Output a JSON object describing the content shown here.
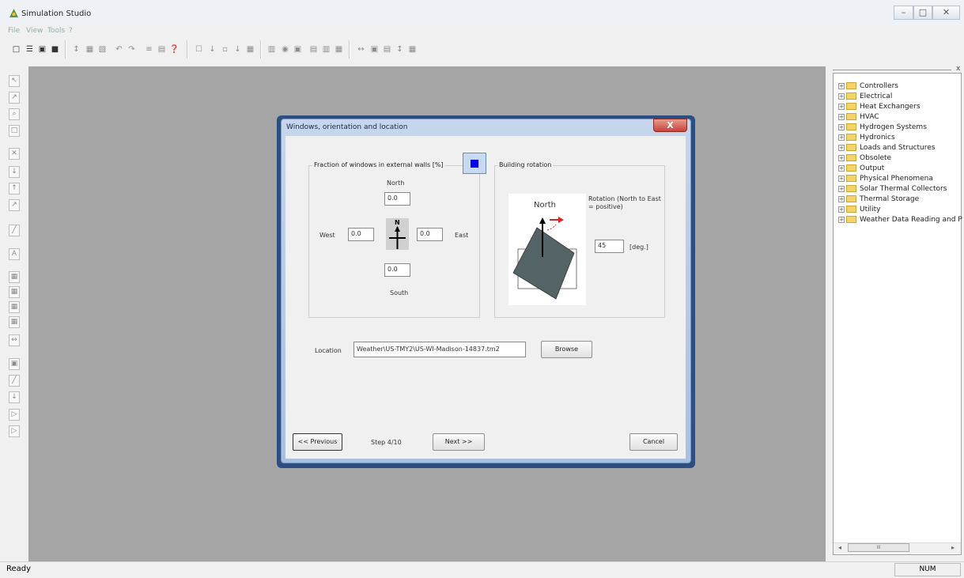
{
  "window": {
    "title": "Simulation Studio",
    "min": "–",
    "max": "□",
    "close": "✕"
  },
  "menu": [
    "File",
    "View",
    "Tools",
    "?"
  ],
  "toolbar_icons": [
    "□",
    "☰",
    "▣",
    "■",
    "↕",
    "▦",
    "▧",
    "↶",
    "↷",
    "≡",
    "▤",
    "❓",
    "☐",
    "↓",
    "▫",
    "↓",
    "▦",
    "▥",
    "◉",
    "▣",
    "▤",
    "▥",
    "▦",
    "↔",
    "▣",
    "▤",
    "↕",
    "▦"
  ],
  "left_tools": [
    "↖",
    "↗",
    "⌕",
    "□",
    "✕",
    "↓",
    "↑",
    "↗",
    "╱",
    "A",
    "▦",
    "▦",
    "▦",
    "▦",
    "↔",
    "▣",
    "╱",
    "↓",
    "▷",
    "▷"
  ],
  "tree": {
    "close": "x",
    "items": [
      "Controllers",
      "Electrical",
      "Heat Exchangers",
      "HVAC",
      "Hydrogen Systems",
      "Hydronics",
      "Loads and Structures",
      "Obsolete",
      "Output",
      "Physical Phenomena",
      "Solar Thermal Collectors",
      "Thermal Storage",
      "Utility",
      "Weather Data Reading and P"
    ],
    "scroll_label": "III"
  },
  "status": {
    "text": "Ready",
    "num": "NUM"
  },
  "dialog": {
    "title": "Windows, orientation and location",
    "close": "X",
    "windows": {
      "label": "Fraction of windows in external walls [%]",
      "north_label": "North",
      "north_value": "0.0",
      "west_label": "West",
      "west_value": "0.0",
      "east_label": "East",
      "east_value": "0.0",
      "south_label": "South",
      "south_value": "0.0",
      "compass_letter": "N"
    },
    "rotation": {
      "label": "Building rotation",
      "preview_north": "North",
      "desc": "Rotation (North to East = positive)",
      "value": "45",
      "unit": "[deg.]"
    },
    "location": {
      "label": "Location",
      "value": "Weather\\US-TMY2\\US-WI-Madison-14837.tm2",
      "browse": "Browse"
    },
    "nav": {
      "previous": "<< Previous",
      "step": "Step 4/10",
      "next": "Next >>",
      "cancel": "Cancel"
    }
  },
  "colors": {
    "canvas": "#a5a5a5",
    "dialog_frame": "#b9cce6",
    "close_red": "#c8443a",
    "building": "#546366"
  }
}
